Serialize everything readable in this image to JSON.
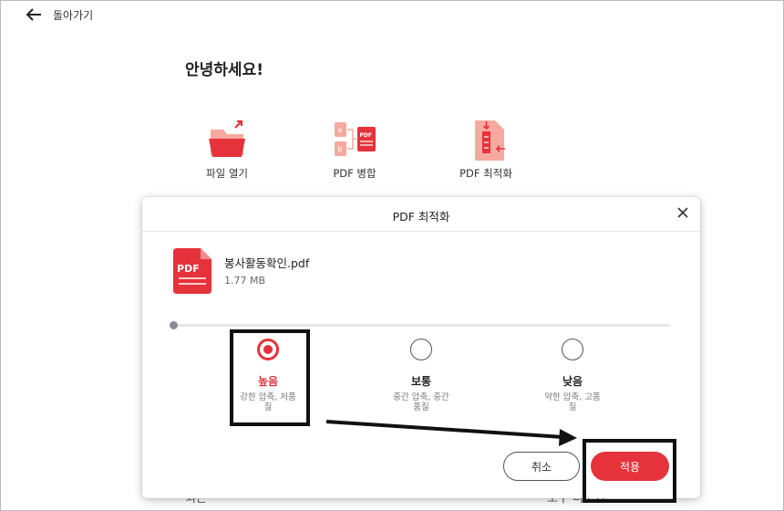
{
  "nav": {
    "back_label": "돌아가기"
  },
  "greeting": "안녕하세요!",
  "tools": [
    {
      "label": "파일 열기",
      "icon": "folder-open-icon"
    },
    {
      "label": "PDF 병합",
      "icon": "merge-pdf-icon"
    },
    {
      "label": "PDF 최적화",
      "icon": "compress-pdf-icon"
    }
  ],
  "behind": {
    "left_text": "최근",
    "right_text": "도구 더보기"
  },
  "dialog": {
    "title": "PDF 최적화",
    "file": {
      "icon_text": "PDF",
      "name": "봉사활동확인.pdf",
      "size": "1.77 MB"
    },
    "options": [
      {
        "label": "높음",
        "desc": "강한 압축, 저품질",
        "selected": true
      },
      {
        "label": "보통",
        "desc": "중간 압축, 중간 품질",
        "selected": false
      },
      {
        "label": "낮음",
        "desc": "약한 압축, 고품질",
        "selected": false
      }
    ],
    "cancel_label": "취소",
    "apply_label": "적용"
  },
  "colors": {
    "accent": "#e5323b",
    "annotation": "#111111"
  }
}
